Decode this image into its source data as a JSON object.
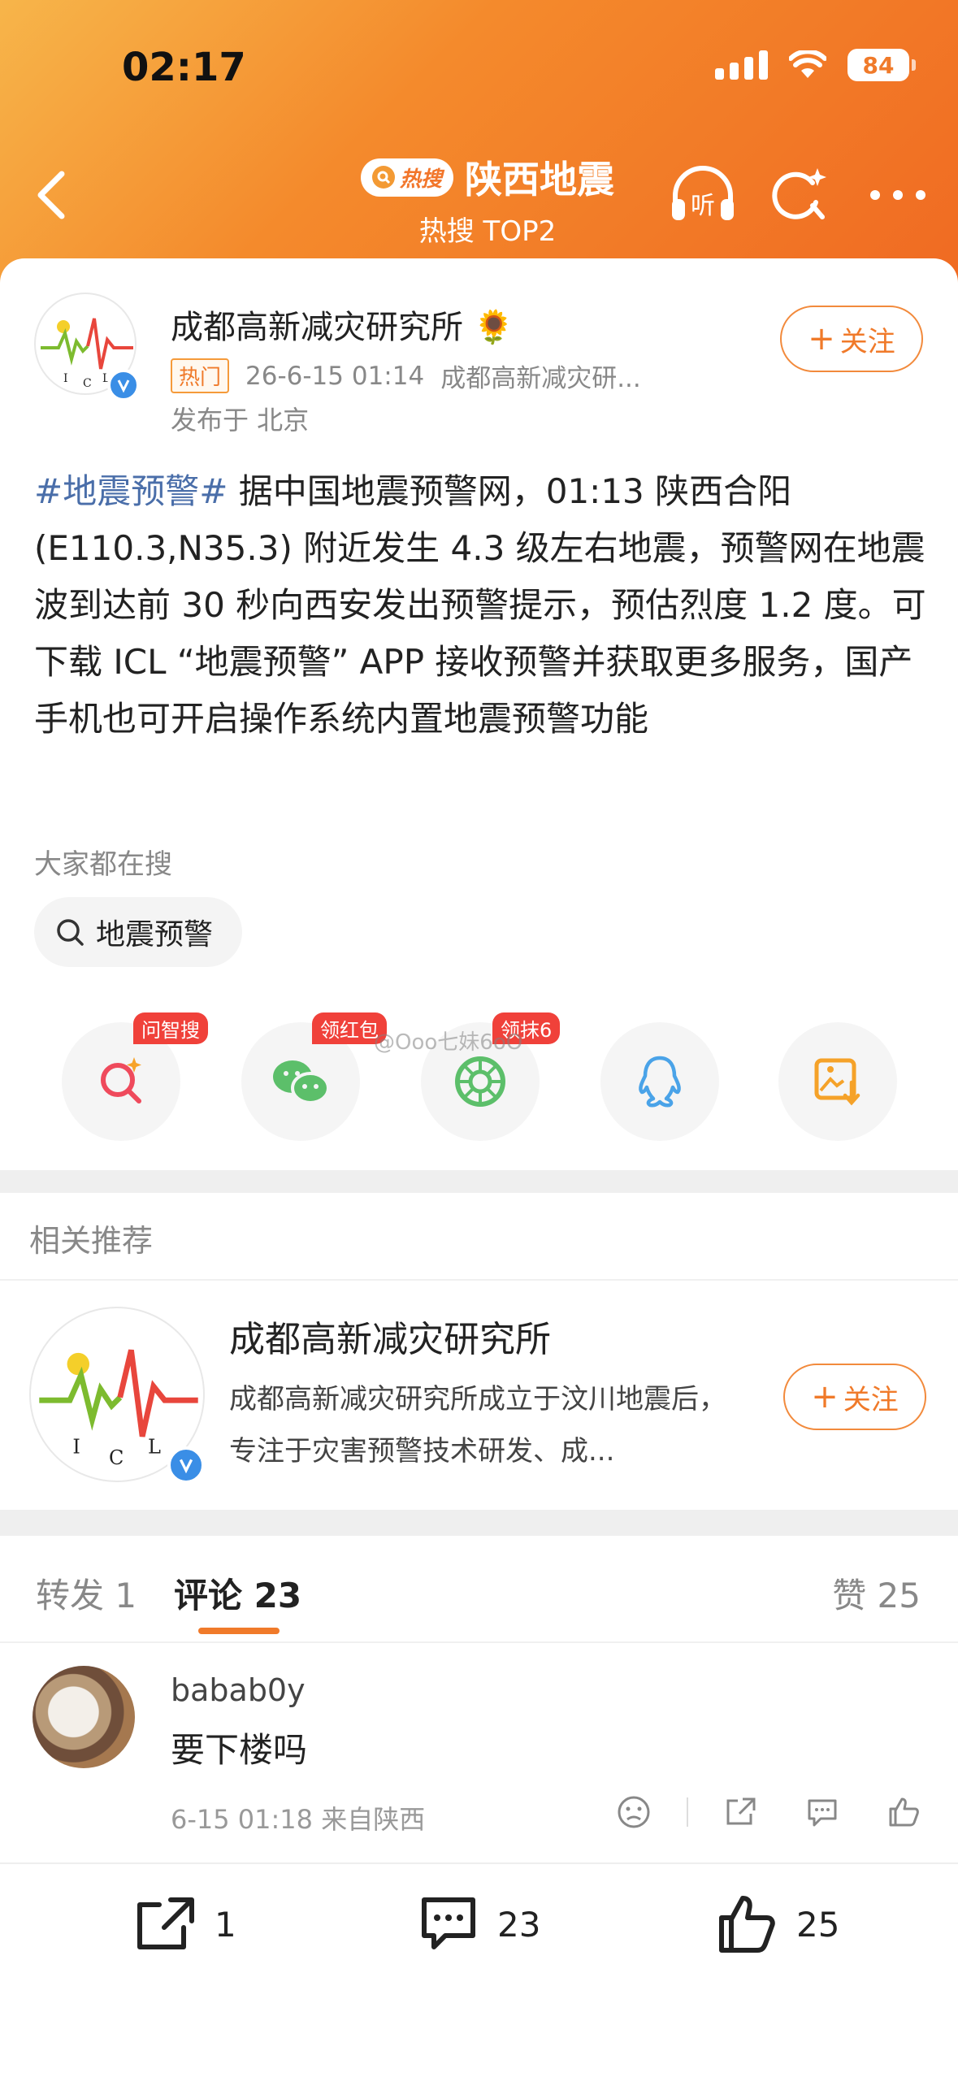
{
  "status_bar": {
    "time": "02:17",
    "battery": "84"
  },
  "header": {
    "hot_badge": "热搜",
    "title": "陕西地震",
    "subtitle": "热搜 TOP2",
    "listen_label": "听"
  },
  "post": {
    "author": "成都高新减灾研究所",
    "author_emoji": "🌻",
    "tag": "热门",
    "time": "26-6-15 01:14",
    "source": "成都高新减灾研...",
    "location": "发布于 北京",
    "follow_label": "关注",
    "hashtag": "#地震预警#",
    "text": " 据中国地震预警网，01:13 陕西合阳 (E110.3,N35.3) 附近发生 4.3 级左右地震，预警网在地震波到达前 30 秒向西安发出预警提示，预估烈度 1.2 度。可下载 ICL “地震预警” APP 接收预警并获取更多服务，国产手机也可开启操作系统内置地震预警功能"
  },
  "search": {
    "label": "大家都在搜",
    "chip": "地震预警"
  },
  "share": {
    "badges": [
      "问智搜",
      "领红包",
      "领抹6"
    ],
    "watermark": "@Ooo七妹6oO",
    "items": [
      "ai-search-icon",
      "wechat-icon",
      "moments-icon",
      "qq-icon",
      "save-image-icon"
    ]
  },
  "recommend": {
    "title": "相关推荐",
    "name": "成都高新减灾研究所",
    "desc": "成都高新减灾研究所成立于汶川地震后，专注于灾害预警技术研发、成...",
    "follow_label": "关注"
  },
  "tabs": {
    "repost": "转发 1",
    "comment": "评论 23",
    "like": "赞 25"
  },
  "comment": {
    "user": "babab0y",
    "text": "要下楼吗",
    "meta": "6-15 01:18 来自陕西"
  },
  "bottom_bar": {
    "repost": "1",
    "comment": "23",
    "like": "25"
  },
  "colors": {
    "accent": "#f07a2a",
    "hashtag": "#4a6ea9",
    "verified": "#3a8ee6"
  }
}
